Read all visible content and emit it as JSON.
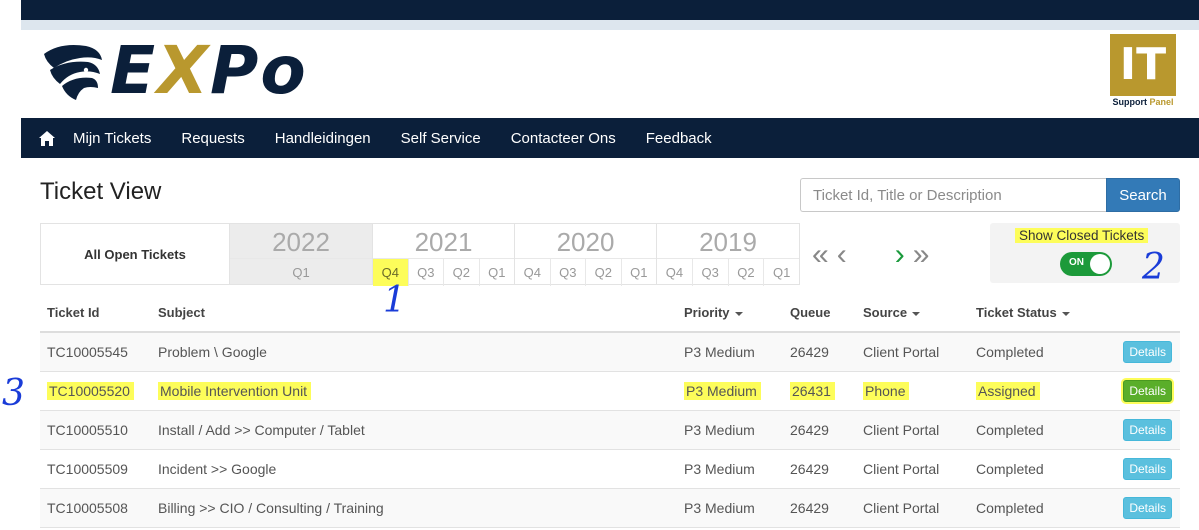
{
  "header": {
    "logo_text_prefix": "E",
    "logo_text_x": "X",
    "logo_text_suffix": "Po",
    "badge_title": "IT",
    "badge_sub_1": "Support ",
    "badge_sub_2": "Panel"
  },
  "nav": {
    "home_icon": "home-icon",
    "items": [
      "Mijn Tickets",
      "Requests",
      "Handleidingen",
      "Self Service",
      "Contacteer Ons",
      "Feedback"
    ]
  },
  "page": {
    "title": "Ticket View"
  },
  "search": {
    "placeholder": "Ticket Id, Title or Description",
    "button_label": "Search"
  },
  "filter": {
    "all_open_label": "All Open Tickets",
    "years": [
      {
        "year": "2022",
        "quarters": [
          "Q1"
        ]
      },
      {
        "year": "2021",
        "quarters": [
          "Q4",
          "Q3",
          "Q2",
          "Q1"
        ]
      },
      {
        "year": "2020",
        "quarters": [
          "Q4",
          "Q3",
          "Q2",
          "Q1"
        ]
      },
      {
        "year": "2019",
        "quarters": [
          "Q4",
          "Q3",
          "Q2",
          "Q1"
        ]
      }
    ],
    "pager": {
      "first": "«",
      "prev": "‹",
      "next": "›",
      "last": "»"
    }
  },
  "closed_toggle": {
    "label": "Show Closed Tickets",
    "state": "ON"
  },
  "annotations": [
    "1",
    "2",
    "3"
  ],
  "table": {
    "headers": {
      "id": "Ticket Id",
      "subject": "Subject",
      "priority": "Priority",
      "queue": "Queue",
      "source": "Source",
      "status": "Ticket Status"
    },
    "details_label": "Details",
    "rows": [
      {
        "id": "TC10005545",
        "subject": "Problem \\ Google",
        "priority": "P3 Medium",
        "queue": "26429",
        "source": "Client Portal",
        "status": "Completed"
      },
      {
        "id": "TC10005520",
        "subject": "Mobile Intervention Unit",
        "priority": "P3 Medium",
        "queue": "26431",
        "source": "Phone",
        "status": "Assigned"
      },
      {
        "id": "TC10005510",
        "subject": "Install / Add >> Computer / Tablet",
        "priority": "P3 Medium",
        "queue": "26429",
        "source": "Client Portal",
        "status": "Completed"
      },
      {
        "id": "TC10005509",
        "subject": "Incident >> Google",
        "priority": "P3 Medium",
        "queue": "26429",
        "source": "Client Portal",
        "status": "Completed"
      },
      {
        "id": "TC10005508",
        "subject": "Billing >> CIO / Consulting / Training",
        "priority": "P3 Medium",
        "queue": "26429",
        "source": "Client Portal",
        "status": "Completed"
      }
    ]
  },
  "colors": {
    "navy": "#0b1f3a",
    "gold": "#b9982e",
    "highlight": "#fdfd5a",
    "toggle_on": "#1c9a3a",
    "info_btn": "#5bc0de"
  }
}
